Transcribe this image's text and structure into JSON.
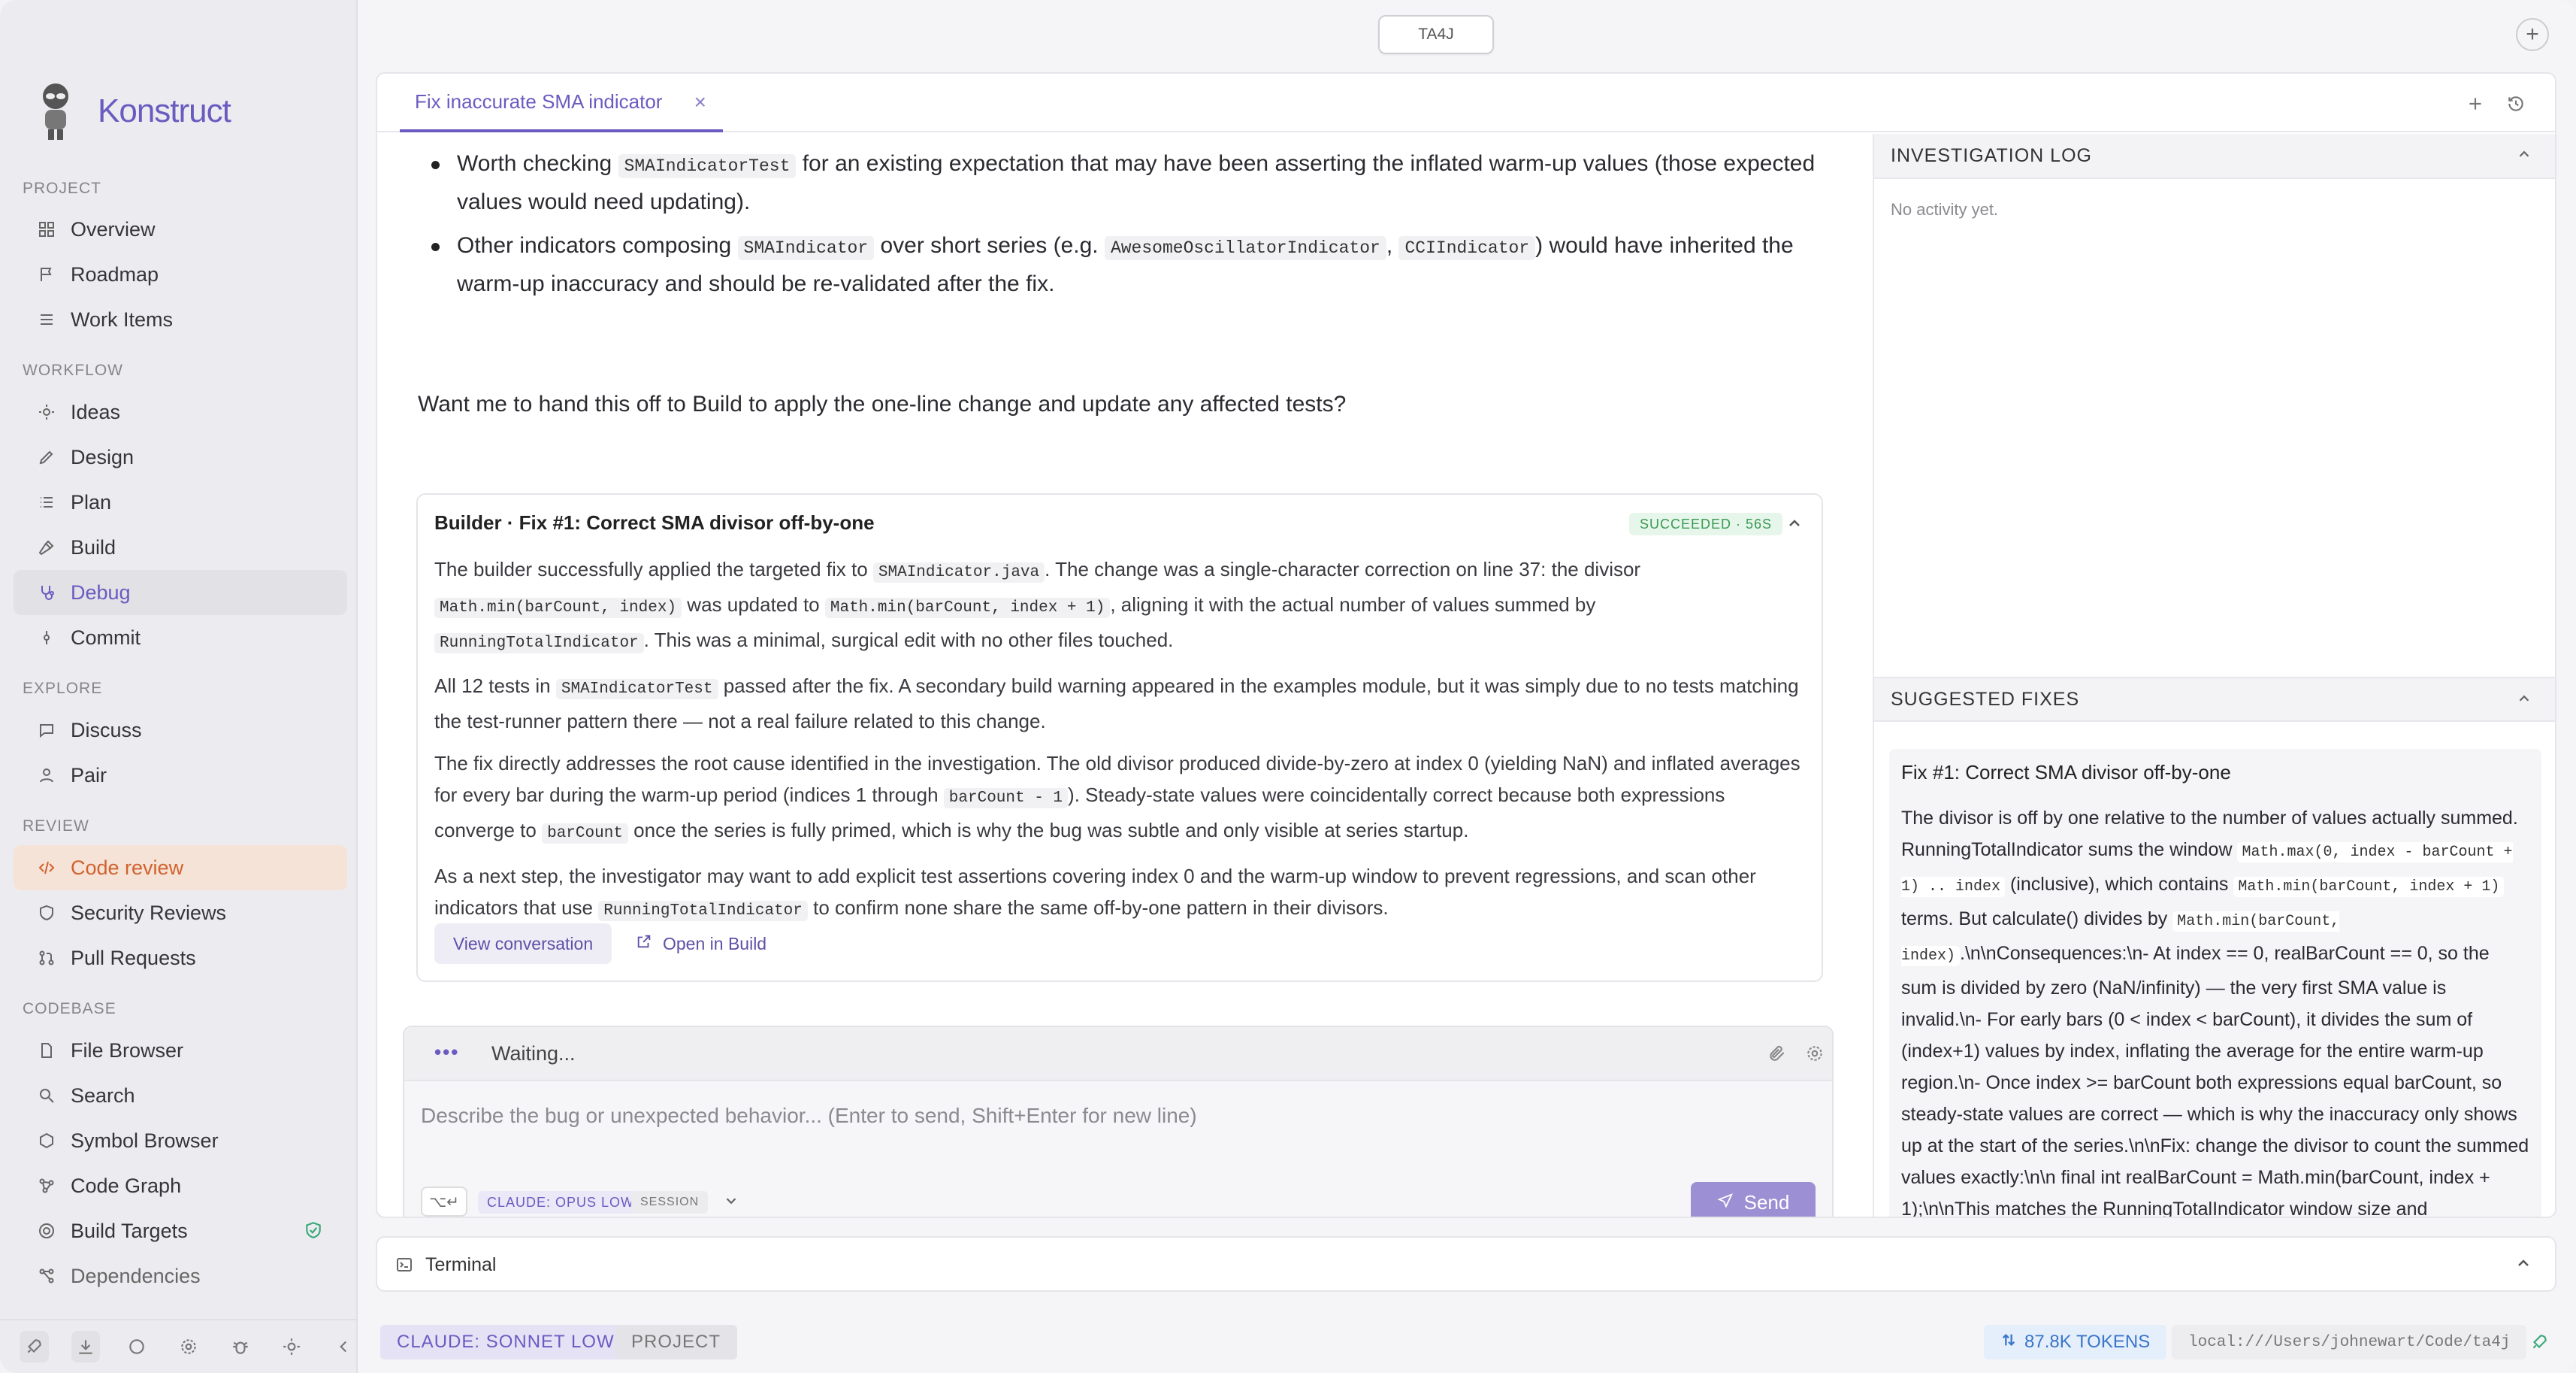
{
  "window": {
    "top_button": "TA4J"
  },
  "sidebar": {
    "brand": "Konstruct",
    "sections": {
      "project": "PROJECT",
      "workflow": "WORKFLOW",
      "explore": "EXPLORE",
      "review": "REVIEW",
      "codebase": "CODEBASE"
    },
    "items": [
      {
        "label": "Overview",
        "icon": "grid-icon"
      },
      {
        "label": "Roadmap",
        "icon": "flag-icon"
      },
      {
        "label": "Work Items",
        "icon": "list-icon"
      },
      {
        "label": "Ideas",
        "icon": "lightbulb-icon"
      },
      {
        "label": "Design",
        "icon": "pen-icon"
      },
      {
        "label": "Plan",
        "icon": "list-icon"
      },
      {
        "label": "Build",
        "icon": "hammer-icon"
      },
      {
        "label": "Debug",
        "icon": "stethoscope-icon"
      },
      {
        "label": "Commit",
        "icon": "commit-icon"
      },
      {
        "label": "Discuss",
        "icon": "chat-icon"
      },
      {
        "label": "Pair",
        "icon": "person-icon"
      },
      {
        "label": "Code review",
        "icon": "code-icon"
      },
      {
        "label": "Security Reviews",
        "icon": "shield-icon"
      },
      {
        "label": "Pull Requests",
        "icon": "pull-request-icon"
      },
      {
        "label": "File Browser",
        "icon": "file-icon"
      },
      {
        "label": "Search",
        "icon": "search-icon"
      },
      {
        "label": "Symbol Browser",
        "icon": "symbol-icon"
      },
      {
        "label": "Code Graph",
        "icon": "graph-icon"
      },
      {
        "label": "Build Targets",
        "icon": "target-icon"
      },
      {
        "label": "Dependencies",
        "icon": "dependencies-icon"
      }
    ]
  },
  "tab": {
    "label": "Fix inaccurate SMA indicator"
  },
  "chat": {
    "bullet1": {
      "a": "Worth checking ",
      "code1": "SMAIndicatorTest",
      "b": " for an existing expectation that may have been asserting the inflated warm-up values (those expected values would need updating)."
    },
    "bullet2": {
      "a": "Other indicators composing ",
      "code1": "SMAIndicator",
      "b": " over short series (e.g. ",
      "code2": "AwesomeOscillatorIndicator",
      "c": ", ",
      "code3": "CCIIndicator",
      "d": ") would have inherited the warm-up inaccuracy and should be re-validated after the fix."
    },
    "ask": "Want me to hand this off to Build to apply the one-line change and update any affected tests?"
  },
  "card": {
    "title": "Builder · Fix #1: Correct SMA divisor off-by-one",
    "badge": "SUCCEEDED · 56S",
    "p1": {
      "a": "The builder successfully applied the targeted fix to ",
      "c1": "SMAIndicator.java",
      "b": ". The change was a single-character correction on line 37: the divisor ",
      "c2": "Math.min(barCount, index)",
      "c": " was updated to ",
      "c3": "Math.min(barCount, index + 1)",
      "d": ", aligning it with the actual number of values summed by ",
      "c4": "RunningTotalIndicator",
      "e": ". This was a minimal, surgical edit with no other files touched."
    },
    "p2": {
      "a": "All 12 tests in ",
      "c1": "SMAIndicatorTest",
      "b": " passed after the fix. A secondary build warning appeared in the examples module, but it was simply due to no tests matching the test-runner pattern there — not a real failure related to this change."
    },
    "p3": {
      "a": "The fix directly addresses the root cause identified in the investigation. The old divisor produced divide-by-zero at index 0 (yielding NaN) and inflated averages for every bar during the warm-up period (indices 1 through ",
      "c1": "barCount - 1",
      "b": "). Steady-state values were coincidentally correct because both expressions converge to ",
      "c2": "barCount",
      "c": " once the series is fully primed, which is why the bug was subtle and only visible at series startup."
    },
    "p4": {
      "a": "As a next step, the investigator may want to add explicit test assertions covering index 0 and the warm-up window to prevent regressions, and scan other indicators that use ",
      "c1": "RunningTotalIndicator",
      "b": " to confirm none share the same off-by-one pattern in their divisors."
    },
    "view_conversation": "View conversation",
    "open_in_build": "Open in Build"
  },
  "composer": {
    "status": "Waiting...",
    "placeholder": "Describe the bug or unexpected behavior... (Enter to send, Shift+Enter for new line)",
    "key_hint": "⌥↵",
    "model": "CLAUDE: OPUS LOW",
    "scope": "SESSION",
    "send": "Send",
    "id": "0a8366fc-9bd9-4826-b0e6-fb843e2971eb"
  },
  "right_panel": {
    "investigation_title": "INVESTIGATION LOG",
    "no_activity": "No activity yet.",
    "fixes_title": "SUGGESTED FIXES",
    "fix_title": "Fix #1: Correct SMA divisor off-by-one",
    "fix_a": "The divisor is off by one relative to the number of values actually summed. RunningTotalIndicator sums the window ",
    "fix_c1": "Math.max(0, index - barCount + 1) .. index",
    "fix_b": " (inclusive), which contains ",
    "fix_c2": "Math.min(barCount, index + 1)",
    "fix_c": " terms. But calculate() divides by ",
    "fix_c3": "Math.min(barCount, index)",
    "fix_d": ".\\n\\nConsequences:\\n- At index == 0, realBarCount == 0, so the sum is divided by zero (NaN/infinity) — the very first SMA value is invalid.\\n- For early bars (0 < index < barCount), it divides the sum of (index+1) values by index, inflating the average for the entire warm-up region.\\n- Once index >= barCount both expressions equal barCount, so steady-state values are correct — which is why the inaccuracy only shows up at the start of the series.\\n\\nFix: change the divisor to count the summed values exactly:\\n\\n final int realBarCount = Math.min(barCount, index + 1);\\n\\nThis matches the RunningTotalIndicator window size and"
  },
  "terminal": {
    "label": "Terminal"
  },
  "statusbar": {
    "model": "CLAUDE: SONNET LOW",
    "project": "PROJECT",
    "tokens": "87.8K TOKENS",
    "path": "local:///Users/johnewart/Code/ta4j"
  }
}
